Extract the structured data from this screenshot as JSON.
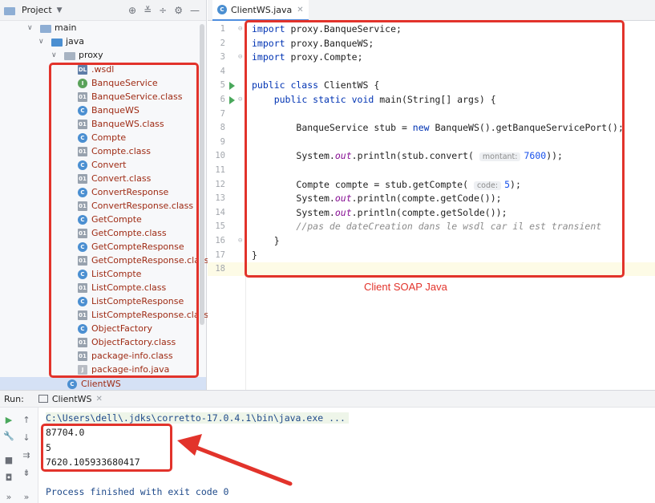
{
  "project_panel": {
    "title": "Project",
    "tree": [
      {
        "label": "main",
        "kind": "folder",
        "indent": 0
      },
      {
        "label": "java",
        "kind": "folder",
        "indent": 1
      },
      {
        "label": "proxy",
        "kind": "package",
        "indent": 2
      }
    ],
    "files": [
      {
        "label": ".wsdl",
        "icon": "dl"
      },
      {
        "label": "BanqueService",
        "icon": "i"
      },
      {
        "label": "BanqueService.class",
        "icon": "cls"
      },
      {
        "label": "BanqueWS",
        "icon": "c"
      },
      {
        "label": "BanqueWS.class",
        "icon": "cls"
      },
      {
        "label": "Compte",
        "icon": "c"
      },
      {
        "label": "Compte.class",
        "icon": "cls"
      },
      {
        "label": "Convert",
        "icon": "c"
      },
      {
        "label": "Convert.class",
        "icon": "cls"
      },
      {
        "label": "ConvertResponse",
        "icon": "c"
      },
      {
        "label": "ConvertResponse.class",
        "icon": "cls"
      },
      {
        "label": "GetCompte",
        "icon": "c"
      },
      {
        "label": "GetCompte.class",
        "icon": "cls"
      },
      {
        "label": "GetCompteResponse",
        "icon": "c"
      },
      {
        "label": "GetCompteResponse.class",
        "icon": "cls"
      },
      {
        "label": "ListCompte",
        "icon": "c"
      },
      {
        "label": "ListCompte.class",
        "icon": "cls"
      },
      {
        "label": "ListCompteResponse",
        "icon": "c"
      },
      {
        "label": "ListCompteResponse.class",
        "icon": "cls"
      },
      {
        "label": "ObjectFactory",
        "icon": "c"
      },
      {
        "label": "ObjectFactory.class",
        "icon": "cls"
      },
      {
        "label": "package-info.class",
        "icon": "cls"
      },
      {
        "label": "package-info.java",
        "icon": "j"
      }
    ],
    "selected_file": "ClientWS"
  },
  "editor": {
    "tab_label": "ClientWS.java",
    "line_numbers": [
      "1",
      "2",
      "3",
      "4",
      "5",
      "6",
      "7",
      "8",
      "9",
      "10",
      "11",
      "12",
      "13",
      "14",
      "15",
      "16",
      "17",
      "18"
    ],
    "code": {
      "l1": "proxy.BanqueService;",
      "l2": "proxy.BanqueWS;",
      "l3": "proxy.Compte;",
      "kw_import": "import",
      "l5_kw": "public class",
      "l5_rest": " ClientWS {",
      "l6_kw": "public static void",
      "l6_rest": " main(String[] args) {",
      "l8_a": "BanqueService stub = ",
      "l8_kw": "new",
      "l8_b": " BanqueWS().getBanqueServicePort();",
      "l10_a": "System.",
      "out": "out",
      "l10_b": ".println(stub.convert( ",
      "l10_hint": "montant:",
      "l10_num": "7600",
      "l10_c": "));",
      "l12_a": "Compte compte = stub.getCompte( ",
      "l12_hint": "code:",
      "l12_num": "5",
      "l12_c": ");",
      "l13_b": ".println(compte.getCode());",
      "l14_b": ".println(compte.getSolde());",
      "l15": "//pas de dateCreation dans le wsdl car il est transient",
      "l16": "}",
      "l17": "}"
    },
    "annotation_label": "Client SOAP Java"
  },
  "run_panel": {
    "label": "Run:",
    "tab_label": "ClientWS",
    "command": "C:\\Users\\dell\\.jdks\\corretto-17.0.4.1\\bin\\java.exe ...",
    "output": [
      "87704.0",
      "5",
      "7620.105933680417"
    ],
    "exit_message": "Process finished with exit code 0"
  },
  "colors": {
    "accent": "#4f8edf",
    "annotation": "#e2332b",
    "run_green": "#4aa85c"
  }
}
